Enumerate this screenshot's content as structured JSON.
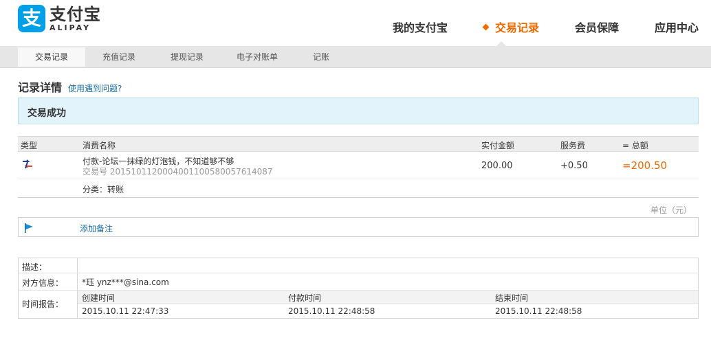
{
  "brand": {
    "badge": "支",
    "name_cn": "支付宝",
    "name_en": "ALIPAY",
    "color": "#00a0e9"
  },
  "main_nav": {
    "items": [
      {
        "label": "我的支付宝"
      },
      {
        "label": "交易记录"
      },
      {
        "label": "会员保障"
      },
      {
        "label": "应用中心"
      }
    ],
    "active_color": "#f06a00"
  },
  "sub_nav": {
    "items": [
      {
        "label": "交易记录"
      },
      {
        "label": "充值记录"
      },
      {
        "label": "提现记录"
      },
      {
        "label": "电子对账单"
      },
      {
        "label": "记账"
      }
    ]
  },
  "page": {
    "title": "记录详情",
    "help_link": "使用遇到问题?",
    "status": "交易成功"
  },
  "transaction": {
    "headers": {
      "type": "类型",
      "name": "消费名称",
      "amount": "实付金额",
      "fee": "服务费",
      "total": "= 总额"
    },
    "row": {
      "type_icon": "transfer-icon",
      "name": "付款-论坛一抹绿的灯泡钱，不知道够不够",
      "trade_no_label": "交易号",
      "trade_no": "2015101120004001100580057614087",
      "amount": "200.00",
      "fee": "+0.50",
      "total": "=200.50"
    },
    "category_label": "分类：",
    "category": "转账",
    "unit": "单位（元）"
  },
  "remark": {
    "icon": "flag-icon",
    "link": "添加备注"
  },
  "info": {
    "desc_label": "描述：",
    "desc_value": "",
    "party_label": "对方信息：",
    "party_value": "*珏 ynz***@sina.com",
    "time_label": "时间报告：",
    "time_headers": [
      "创建时间",
      "付款时间",
      "结束时间"
    ],
    "time_values": [
      "2015.10.11 22:47:33",
      "2015.10.11 22:48:58",
      "2015.10.11 22:48:58"
    ]
  }
}
